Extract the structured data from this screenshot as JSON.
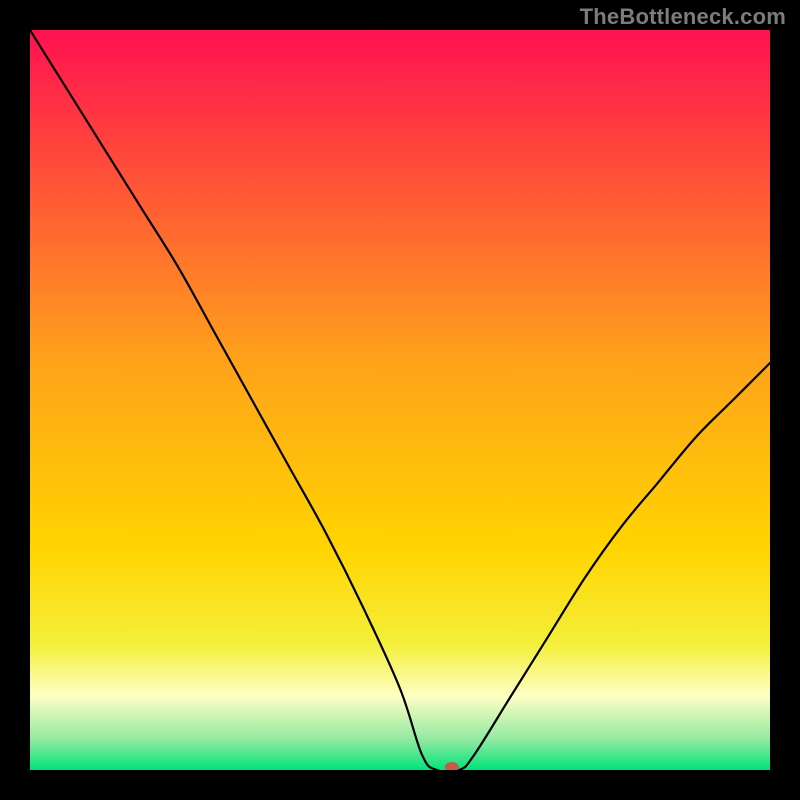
{
  "watermark": "TheBottleneck.com",
  "colors": {
    "top": "#ff1151",
    "mid": "#ffd400",
    "pale": "#feffc4",
    "green": "#00e47a",
    "marker": "#c85a4a",
    "curve": "#000000",
    "frame": "#000000"
  },
  "chart_data": {
    "type": "line",
    "title": "",
    "xlabel": "",
    "ylabel": "",
    "xlim": [
      0,
      100
    ],
    "ylim": [
      0,
      100
    ],
    "x": [
      0,
      5,
      10,
      15,
      20,
      25,
      30,
      35,
      40,
      45,
      50,
      53,
      55,
      58,
      60,
      65,
      70,
      75,
      80,
      85,
      90,
      95,
      100
    ],
    "y": [
      100,
      92,
      84,
      76,
      68,
      59,
      50,
      41,
      32,
      22,
      11,
      2,
      0,
      0,
      2,
      10,
      18,
      26,
      33,
      39,
      45,
      50,
      55
    ],
    "flat_segment": {
      "x0": 53,
      "x1": 58,
      "y": 0
    },
    "marker": {
      "x": 57,
      "y": 0
    },
    "green_band_y": [
      0,
      5
    ],
    "pale_band_y": [
      5,
      15
    ]
  }
}
